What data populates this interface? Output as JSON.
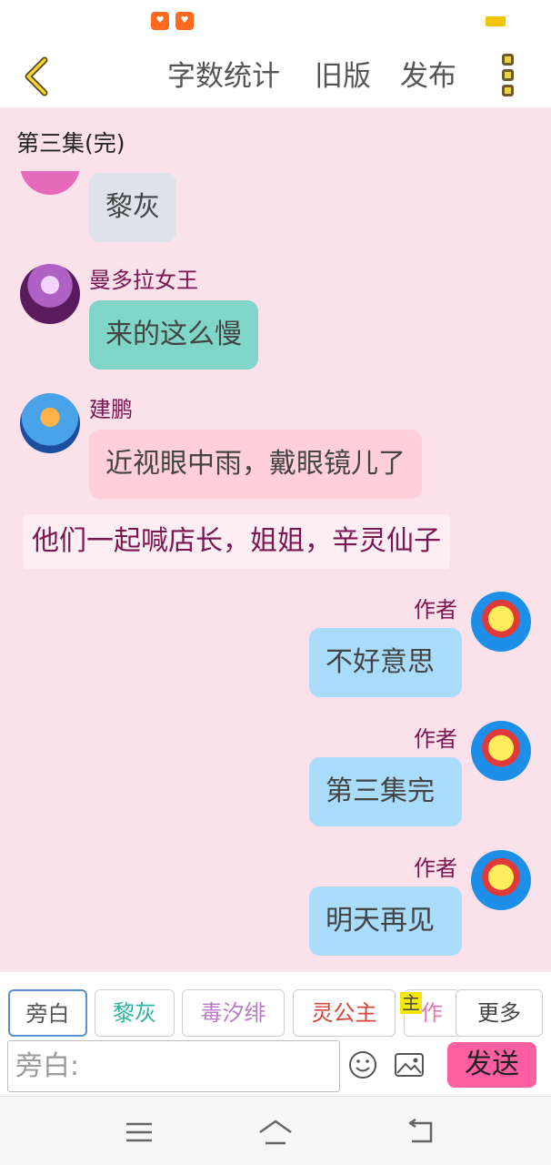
{
  "status_bar": {
    "app_icon_1": "app-icon",
    "app_icon_2": "app-icon"
  },
  "top_bar": {
    "back_icon": "chevron-left-icon",
    "word_count_label": "字数统计",
    "old_version_label": "旧版",
    "publish_label": "发布",
    "more_icon": "kebab-menu-icon"
  },
  "chapter": {
    "title": "第三集(完)"
  },
  "messages": [
    {
      "text": "黎灰"
    },
    {
      "name": "曼多拉女王",
      "text": "来的这么慢"
    },
    {
      "name": "建鹏",
      "text": "近视眼中雨，戴眼镜儿了"
    },
    {
      "narration": "他们一起喊店长，姐姐，辛灵仙子"
    },
    {
      "name": "作者",
      "text": "不好意思"
    },
    {
      "name": "作者",
      "text": "第三集完"
    },
    {
      "name": "作者",
      "text": "明天再见"
    }
  ],
  "roles": [
    {
      "label": "旁白",
      "color": "#555555"
    },
    {
      "label": "黎灰",
      "color": "#2bb5a0"
    },
    {
      "label": "毒汐绯",
      "color": "#b77cc5"
    },
    {
      "label": "灵公主",
      "color": "#d4473b"
    },
    {
      "label": "作者",
      "color": "#e07ab0"
    }
  ],
  "main_badge": "主",
  "more_label": "更多",
  "input": {
    "placeholder": "旁白:"
  },
  "send_label": "发送",
  "colors": {
    "chat_bg": "#fbe1ea",
    "bubble_gray": "#dde3e9",
    "bubble_teal": "#7fd6c8",
    "bubble_pink": "#ffcfdc",
    "bubble_blue": "#a9dcfb",
    "send_button": "#ff5fa0",
    "name_color": "#7a1650"
  },
  "nav_icons": [
    "menu-icon",
    "home-icon",
    "back-icon"
  ]
}
